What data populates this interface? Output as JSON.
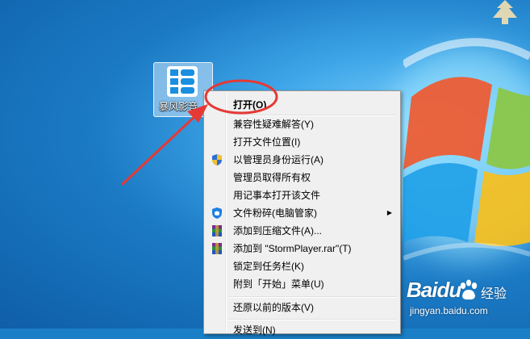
{
  "desktop_icon": {
    "label": "暴风影音",
    "colors": {
      "glyph": "#1a8fe0"
    }
  },
  "context_menu": {
    "items": [
      {
        "label": "打开(O)",
        "bold": true,
        "icon": ""
      },
      {
        "label": "兼容性疑难解答(Y)",
        "icon": ""
      },
      {
        "label": "打开文件位置(I)",
        "icon": ""
      },
      {
        "label": "以管理员身份运行(A)",
        "icon": "uac-shield-icon"
      },
      {
        "label": "管理员取得所有权",
        "icon": ""
      },
      {
        "label": "用记事本打开该文件",
        "icon": ""
      },
      {
        "label": "文件粉碎(电脑管家)",
        "icon": "pc-manager-shield-icon",
        "submenu": true
      },
      {
        "label": "添加到压缩文件(A)...",
        "icon": "winrar-icon"
      },
      {
        "label": "添加到 \"StormPlayer.rar\"(T)",
        "icon": "winrar-icon"
      },
      {
        "label": "锁定到任务栏(K)",
        "icon": ""
      },
      {
        "label": "附到「开始」菜单(U)",
        "icon": ""
      },
      {
        "label": "还原以前的版本(V)",
        "icon": ""
      },
      {
        "label": "发送到(N)",
        "icon": ""
      }
    ],
    "submenu_arrow": "▶"
  },
  "annotation": {
    "circle_color": "#e53935",
    "arrow_color": "#e53935"
  },
  "watermark": {
    "brand": "Baidu",
    "product": "经验",
    "url": "jingyan.baidu.com"
  }
}
